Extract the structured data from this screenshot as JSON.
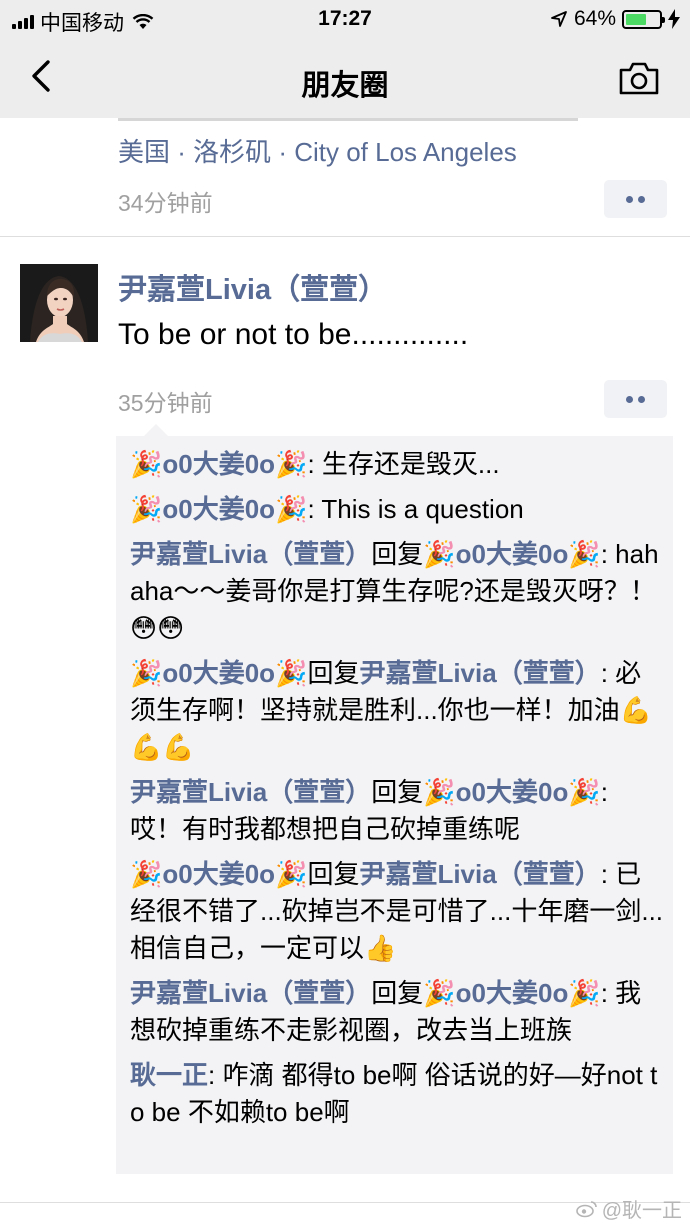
{
  "status_bar": {
    "carrier": "中国移动",
    "time": "17:27",
    "battery_percent": "64%",
    "battery_level": 0.64
  },
  "nav": {
    "title": "朋友圈",
    "back_icon": "chevron-left-icon",
    "camera_icon": "camera-icon"
  },
  "prev_post": {
    "location": "美国 · 洛杉矶 · City of Los Angeles",
    "time_ago": "34分钟前"
  },
  "post": {
    "author": "尹嘉萱Livia（萱萱）",
    "text": "To be or not to be..............",
    "time_ago": "35分钟前"
  },
  "comments": [
    {
      "from": "🎉o0大姜0o🎉",
      "reply_word": "",
      "to": "",
      "text": ": 生存还是毁灭..."
    },
    {
      "from": "🎉o0大姜0o🎉",
      "reply_word": "",
      "to": "",
      "text": ": This is a question"
    },
    {
      "from": "尹嘉萱Livia（萱萱）",
      "reply_word": "回复",
      "to": "🎉o0大姜0o🎉",
      "text": ": hahaha～～姜哥你是打算生存呢?还是毁灭呀？！ 😳😳"
    },
    {
      "from": "🎉o0大姜0o🎉",
      "reply_word": "回复",
      "to": "尹嘉萱Livia（萱萱）",
      "text": ": 必须生存啊！坚持就是胜利...你也一样！加油💪💪💪"
    },
    {
      "from": "尹嘉萱Livia（萱萱）",
      "reply_word": "回复",
      "to": "🎉o0大姜0o🎉",
      "text": ": 哎！有时我都想把自己砍掉重练呢"
    },
    {
      "from": "🎉o0大姜0o🎉",
      "reply_word": "回复",
      "to": "尹嘉萱Livia（萱萱）",
      "text": ": 已经很不错了...砍掉岂不是可惜了...十年磨一剑...相信自己，一定可以👍"
    },
    {
      "from": "尹嘉萱Livia（萱萱）",
      "reply_word": "回复",
      "to": "🎉o0大姜0o🎉",
      "text": ": 我想砍掉重练不走影视圈，改去当上班族"
    },
    {
      "from": "耿一正",
      "reply_word": "",
      "to": "",
      "text": ": 咋滴 都得to be啊 俗话说的好—好not to be 不如赖to be啊"
    }
  ],
  "watermark": "@耿一正",
  "colors": {
    "link": "#576b95",
    "bar_bg": "#ededed",
    "comment_bg": "#f3f3f5",
    "battery_green": "#4cd964"
  }
}
